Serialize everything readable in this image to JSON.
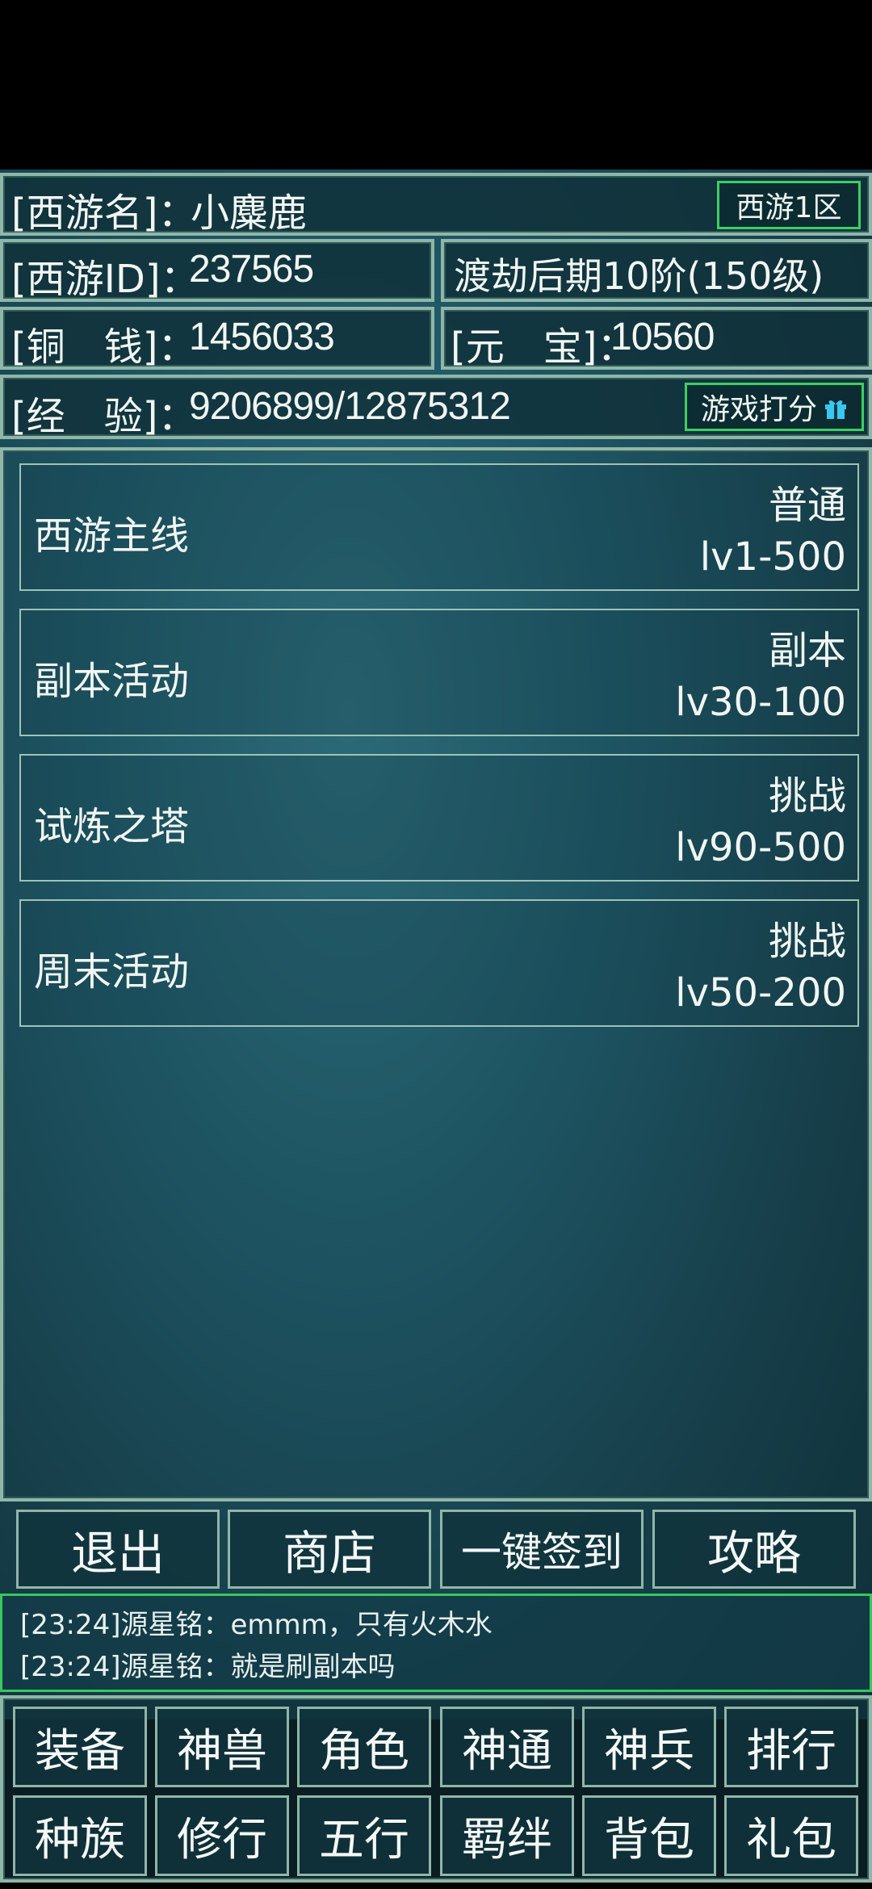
{
  "header": {
    "name_row": {
      "label": "[西游名]：",
      "value": "小麋鹿",
      "server_badge": "西游1区"
    },
    "id_row": {
      "label": "[西游ID]：",
      "value": "237565"
    },
    "realm": "渡劫后期10阶(150级)",
    "copper_row": {
      "label": "[铜　钱]：",
      "value": "1456033"
    },
    "ingot_row": {
      "label": "[元　宝]：",
      "value": "10560"
    },
    "exp_row": {
      "label": "[经　验]：",
      "value": "9206899/12875312",
      "rate_button": "游戏打分"
    }
  },
  "modes": [
    {
      "name": "西游主线",
      "type": "普通",
      "range": "lv1-500"
    },
    {
      "name": "副本活动",
      "type": "副本",
      "range": "lv30-100"
    },
    {
      "name": "试炼之塔",
      "type": "挑战",
      "range": "lv90-500"
    },
    {
      "name": "周末活动",
      "type": "挑战",
      "range": "lv50-200"
    }
  ],
  "actions": [
    "退出",
    "商店",
    "一键签到",
    "攻略"
  ],
  "chat": [
    "[23:24]源星铭：emmm，只有火木水",
    "[23:24]源星铭：就是刷副本吗"
  ],
  "nav_row1": [
    "装备",
    "神兽",
    "角色",
    "神通",
    "神兵",
    "排行"
  ],
  "nav_row2": [
    "种族",
    "修行",
    "五行",
    "羁绊",
    "背包",
    "礼包"
  ],
  "colors": {
    "accent_green": "#3bd061",
    "border": "#8fb6a8",
    "gift_icon": "#39c8f0"
  },
  "icons": {
    "gift": "gift-icon"
  }
}
